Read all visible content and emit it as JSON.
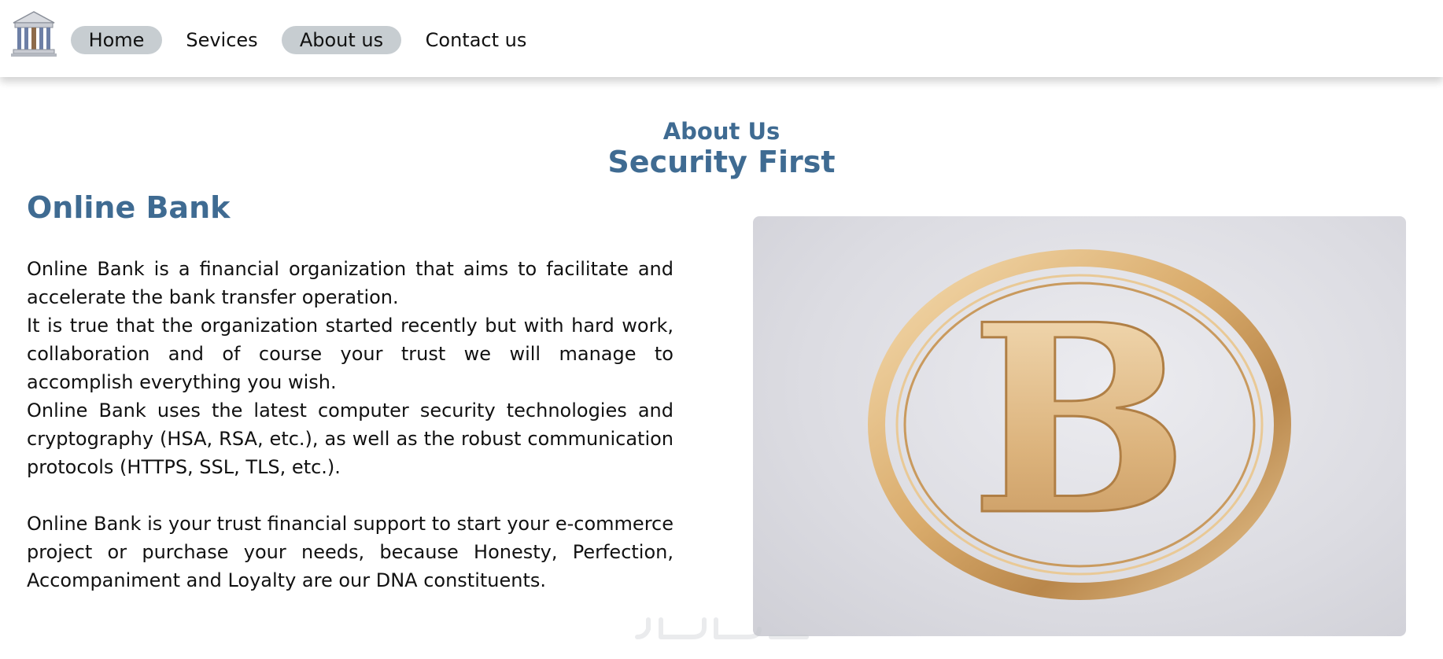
{
  "nav": {
    "items": [
      {
        "label": "Home"
      },
      {
        "label": "Sevices"
      },
      {
        "label": "About us"
      },
      {
        "label": "Contact us"
      }
    ]
  },
  "header": {
    "section_label": "About Us",
    "title": "Security First"
  },
  "content": {
    "heading": "Online Bank",
    "paragraphs": [
      "Online Bank is a financial organization that aims to facilitate and accelerate the bank transfer operation.",
      "It is true that the organization started recently but with hard work, collaboration and of course your trust we will manage to accomplish everything you wish.",
      "Online Bank uses the latest computer security technologies and cryptography (HSA, RSA, etc.), as well as the robust communication protocols (HTTPS, SSL, TLS, etc.).",
      "Online Bank is your trust financial support to start your e-commerce project or purchase your needs, because Honesty, Perfection, Accompaniment and Loyalty are our DNA constituents."
    ]
  },
  "image": {
    "emblem_letter": "B"
  },
  "colors": {
    "accent": "#3f6b92",
    "pill": "#c7cdd1",
    "gold": "#d9b27a"
  },
  "icons": {
    "logo": "bank-building-icon"
  }
}
